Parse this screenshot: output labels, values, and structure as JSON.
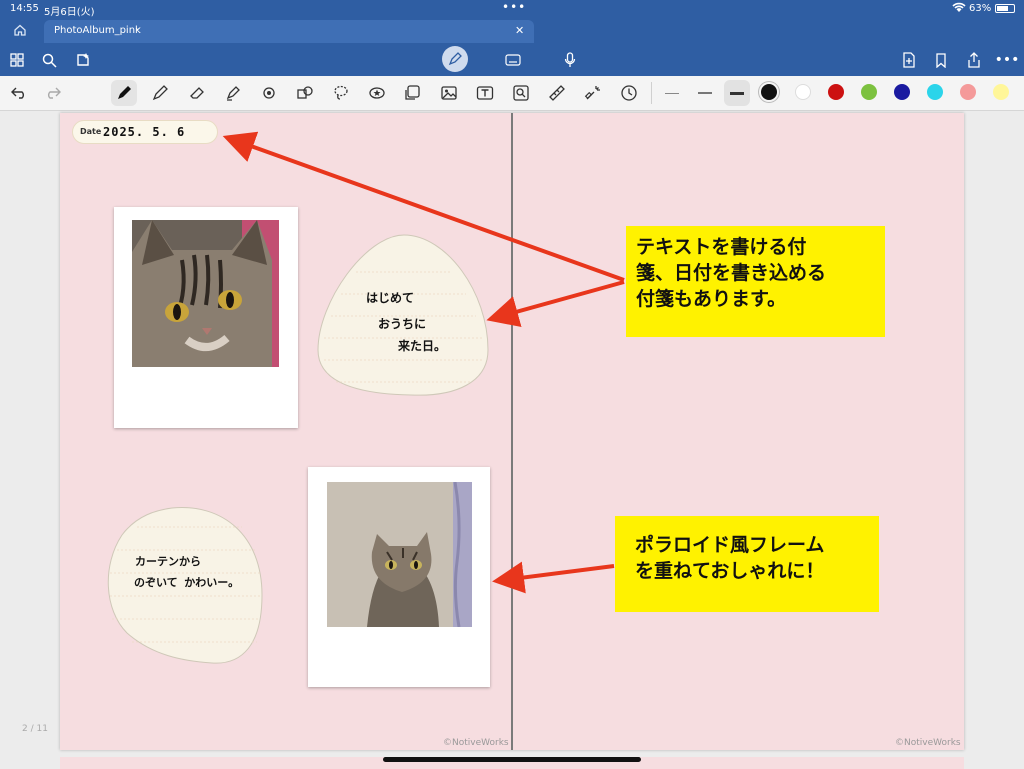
{
  "status_bar": {
    "time": "14:55",
    "date": "5月6日(火)",
    "battery": "63%"
  },
  "tab": {
    "title": "PhotoAlbum_pink"
  },
  "colors": {
    "header_blue": "#2f5ea3",
    "page_pink": "#f6dde0",
    "callout_yellow": "#fff200",
    "arrow_red": "#e8361c",
    "palette": [
      "#111111",
      "#ffffff",
      "#cc1111",
      "#7cc13f",
      "#1a1aa0",
      "#2bd4ea",
      "#f49a9a",
      "#fff699"
    ]
  },
  "page_indicator": "2 / 11",
  "date_sticker": {
    "label": "Date",
    "handwriting": "2025. 5. 6"
  },
  "notes": {
    "note1_lines": [
      "はじめて",
      "おうちに",
      "来た日。"
    ],
    "note2_lines": [
      "カーテンから",
      "のぞいて かわいー。"
    ]
  },
  "callouts": {
    "sticky": [
      "テキストを書ける付",
      "箋、日付を書き込める",
      "付箋もあります。"
    ],
    "polaroid": [
      "ポラロイド風フレーム",
      "を重ねておしゃれに！"
    ]
  },
  "copyright": "©NotiveWorks"
}
